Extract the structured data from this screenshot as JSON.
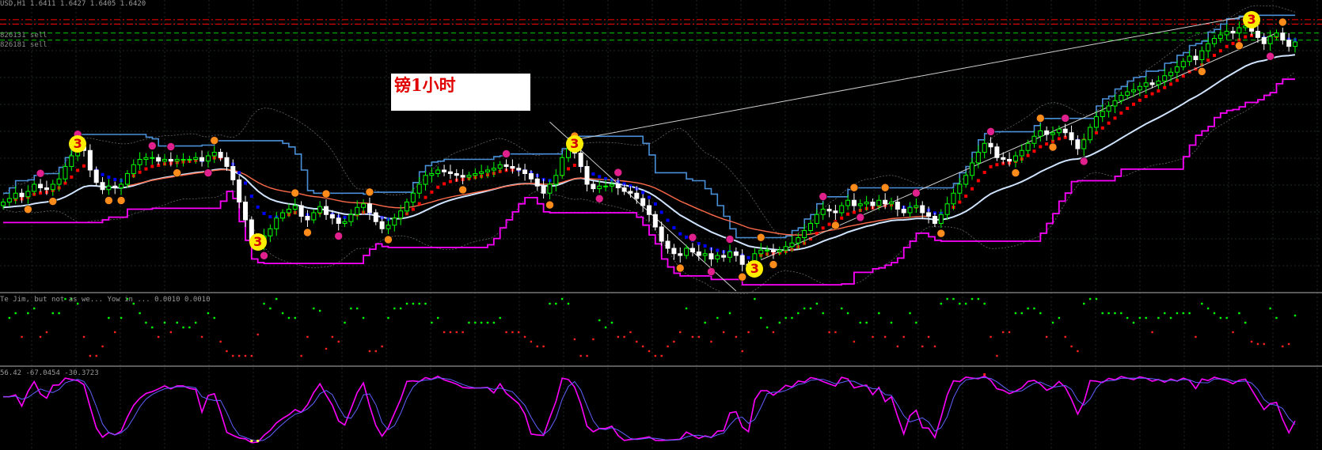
{
  "header": {
    "main_info": "USD,H1  1.6411  1.6427  1.6405  1.6420",
    "indicator1_info": "Te Jim, but not as we... Yow in ...  0.0010 0.0010",
    "indicator2_info": "56.42  -67.0454  -30.3723"
  },
  "labels": {
    "timeframe": "镑1小时",
    "line1": "826131 sell",
    "line2": "826181 sell"
  },
  "wave_marks": [
    {
      "label": "3",
      "bar": 12,
      "level": 1.6465
    },
    {
      "label": "3",
      "bar": 41,
      "level": 1.6355
    },
    {
      "label": "3",
      "bar": 92,
      "level": 1.6465
    },
    {
      "label": "3",
      "bar": 121,
      "level": 1.6325
    },
    {
      "label": "3",
      "bar": 201,
      "level": 1.6605
    }
  ],
  "colors": {
    "background": "#000000",
    "grid": "#1e2d1e",
    "bull_candle": "#00ff00",
    "bear_candle": "#ffffff",
    "upper_channel": "#4a90d9",
    "lower_channel": "#ff00ff",
    "ma_fast": "#d0e4ff",
    "ma_slow": "#ff6a4a",
    "trend_up": "#ff0000",
    "trend_down": "#0000ff",
    "level_red": "#ff0000",
    "level_green": "#00cc00",
    "fractal_orange": "#ff8c1a",
    "fractal_pink": "#e0208c",
    "osc_main": "#ff00ff",
    "osc_signal": "#6060ff",
    "wave_mark": "#ffee00"
  },
  "chart_data": {
    "type": "candlestick",
    "bars": 210,
    "ylim": [
      1.63,
      1.662
    ],
    "horizontal_levels": [
      {
        "value": 1.6605,
        "color": "red",
        "style": "dash-dot"
      },
      {
        "value": 1.66,
        "color": "red",
        "style": "dash-dot"
      },
      {
        "value": 1.659,
        "color": "green",
        "style": "dash"
      },
      {
        "value": 1.6582,
        "color": "green",
        "style": "dash"
      }
    ],
    "close": [
      1.64,
      1.6404,
      1.641,
      1.6406,
      1.6412,
      1.642,
      1.6416,
      1.6414,
      1.642,
      1.6426,
      1.644,
      1.6452,
      1.6462,
      1.6458,
      1.6436,
      1.6422,
      1.6414,
      1.6418,
      1.6416,
      1.642,
      1.6432,
      1.6442,
      1.6448,
      1.645,
      1.645,
      1.6446,
      1.6448,
      1.6446,
      1.6448,
      1.6448,
      1.6448,
      1.645,
      1.6446,
      1.6452,
      1.6456,
      1.645,
      1.644,
      1.6425,
      1.64,
      1.638,
      1.6355,
      1.6352,
      1.6362,
      1.637,
      1.6382,
      1.6388,
      1.6392,
      1.6396,
      1.6384,
      1.638,
      1.6388,
      1.6395,
      1.6386,
      1.6382,
      1.6376,
      1.6378,
      1.6386,
      1.6394,
      1.6398,
      1.6388,
      1.6378,
      1.637,
      1.6374,
      1.6382,
      1.639,
      1.64,
      1.641,
      1.642,
      1.643,
      1.6432,
      1.6436,
      1.6434,
      1.6432,
      1.643,
      1.6428,
      1.643,
      1.6432,
      1.6434,
      1.6436,
      1.6438,
      1.6442,
      1.644,
      1.6438,
      1.6436,
      1.6432,
      1.6426,
      1.6418,
      1.641,
      1.642,
      1.643,
      1.645,
      1.646,
      1.6455,
      1.644,
      1.642,
      1.6415,
      1.6418,
      1.6418,
      1.642,
      1.6416,
      1.6412,
      1.641,
      1.6404,
      1.6396,
      1.6386,
      1.6372,
      1.6356,
      1.6348,
      1.6342,
      1.634,
      1.6348,
      1.6344,
      1.634,
      1.6342,
      1.6336,
      1.634,
      1.6338,
      1.6344,
      1.634,
      1.633,
      1.6328,
      1.6342,
      1.6346,
      1.6346,
      1.6344,
      1.6346,
      1.635,
      1.6354,
      1.636,
      1.6368,
      1.6376,
      1.6386,
      1.6392,
      1.639,
      1.6388,
      1.6396,
      1.6402,
      1.6396,
      1.6398,
      1.64,
      1.6396,
      1.6402,
      1.6398,
      1.64,
      1.6392,
      1.6388,
      1.6394,
      1.6396,
      1.6388,
      1.6384,
      1.6376,
      1.6386,
      1.6398,
      1.641,
      1.642,
      1.643,
      1.6444,
      1.6456,
      1.6466,
      1.6462,
      1.645,
      1.6448,
      1.6446,
      1.6452,
      1.6458,
      1.6466,
      1.6474,
      1.648,
      1.6476,
      1.6478,
      1.6482,
      1.6478,
      1.647,
      1.646,
      1.647,
      1.6484,
      1.6496,
      1.6502,
      1.6508,
      1.6514,
      1.652,
      1.6524,
      1.6526,
      1.653,
      1.6534,
      1.6532,
      1.6536,
      1.6542,
      1.6546,
      1.6552,
      1.6558,
      1.6564,
      1.656,
      1.657,
      1.6578,
      1.6584,
      1.6588,
      1.6592,
      1.659,
      1.6596,
      1.6598,
      1.6592,
      1.6585,
      1.6578,
      1.6586,
      1.659,
      1.6582,
      1.6575,
      1.658
    ]
  }
}
